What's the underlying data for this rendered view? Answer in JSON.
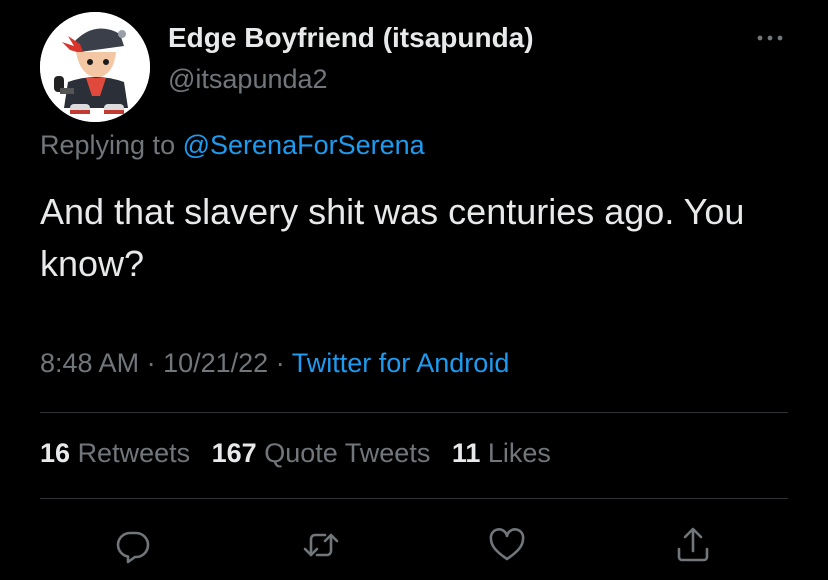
{
  "tweet": {
    "author": {
      "display_name": "Edge Boyfriend (itsapunda)",
      "handle": "@itsapunda2"
    },
    "replying_prefix": "Replying to",
    "replying_to": "@SerenaForSerena",
    "text": "And that slavery shit was centuries ago. You know?",
    "time": "8:48 AM",
    "separator": "·",
    "date": "10/21/22",
    "source": "Twitter for Android"
  },
  "stats": {
    "retweets": {
      "count": "16",
      "label": "Retweets"
    },
    "quote_tweets": {
      "count": "167",
      "label": "Quote Tweets"
    },
    "likes": {
      "count": "11",
      "label": "Likes"
    }
  },
  "actions": [
    {
      "icon": "reply-icon"
    },
    {
      "icon": "retweet-icon"
    },
    {
      "icon": "like-icon"
    },
    {
      "icon": "share-icon"
    }
  ],
  "colors": {
    "background": "#000000",
    "text_primary": "#e7e9ea",
    "text_secondary": "#71767b",
    "accent": "#1d9bf0",
    "divider": "#2f3336"
  }
}
